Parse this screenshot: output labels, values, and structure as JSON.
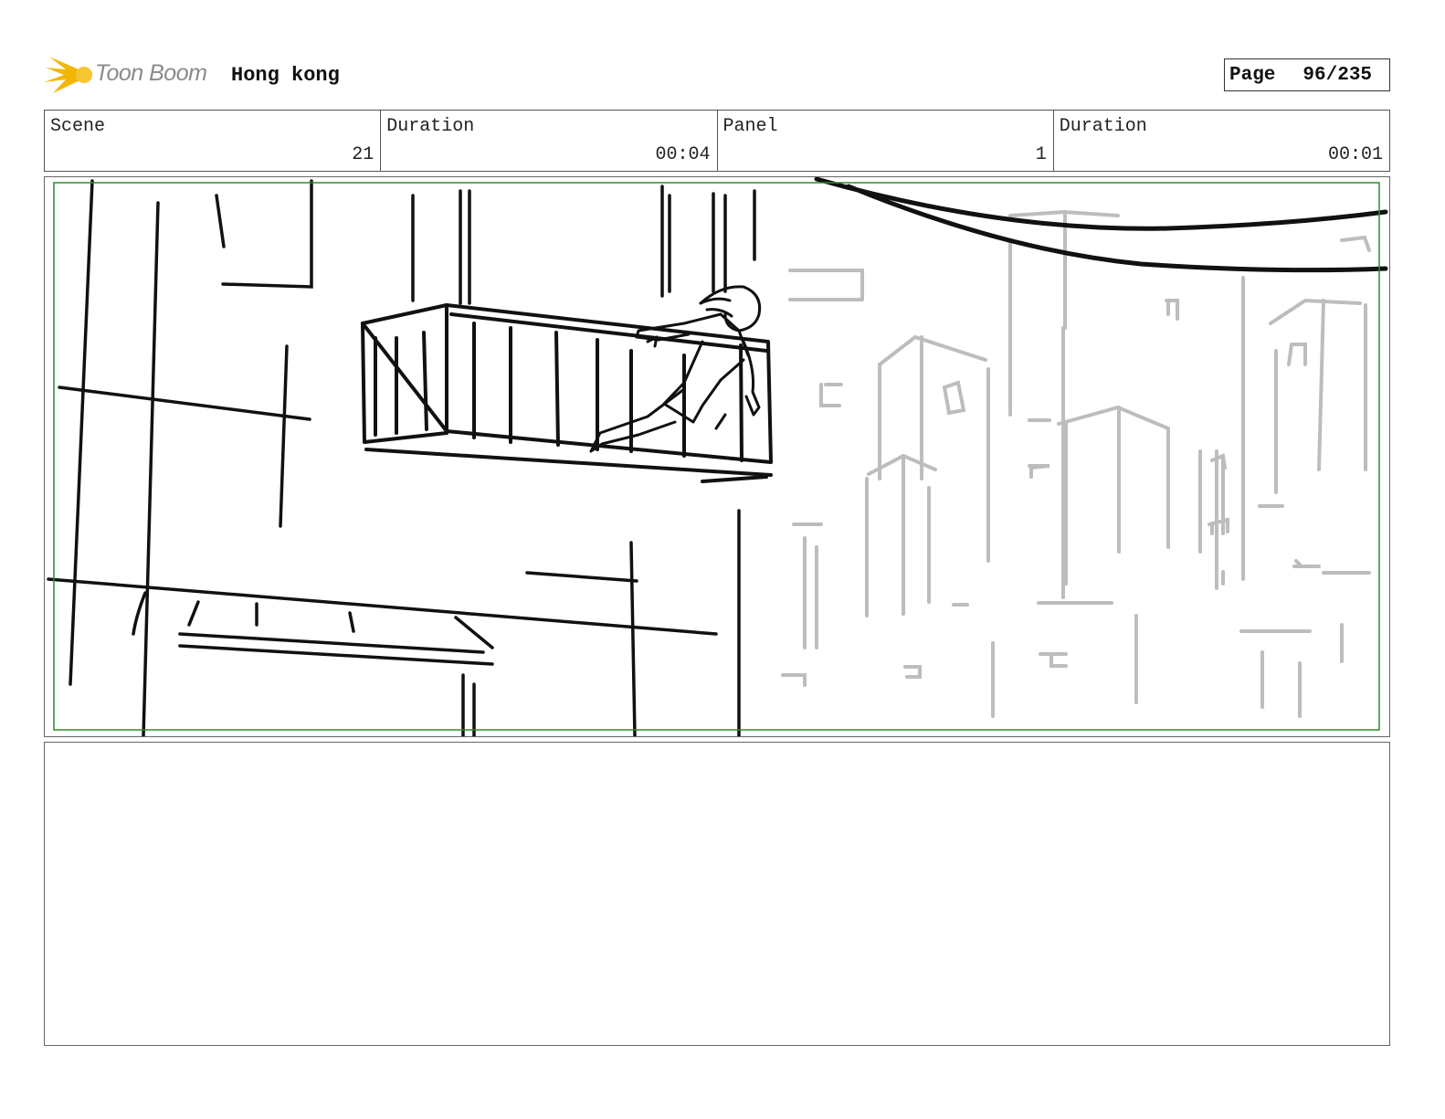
{
  "header": {
    "logo_text": "Toon Boom",
    "project_title": "Hong kong",
    "page_label": "Page",
    "page_value": "96/235"
  },
  "info": {
    "scene_label": "Scene",
    "scene_value": "21",
    "scene_duration_label": "Duration",
    "scene_duration_value": "00:04",
    "panel_label": "Panel",
    "panel_value": "1",
    "panel_duration_label": "Duration",
    "panel_duration_value": "00:01"
  },
  "colors": {
    "logo_yellow": "#f2b705",
    "safe_frame_green": "#2e8b2e",
    "sketch_dark": "#111111",
    "sketch_light": "#bdbdbd"
  },
  "notes": {
    "dialogue": ""
  }
}
